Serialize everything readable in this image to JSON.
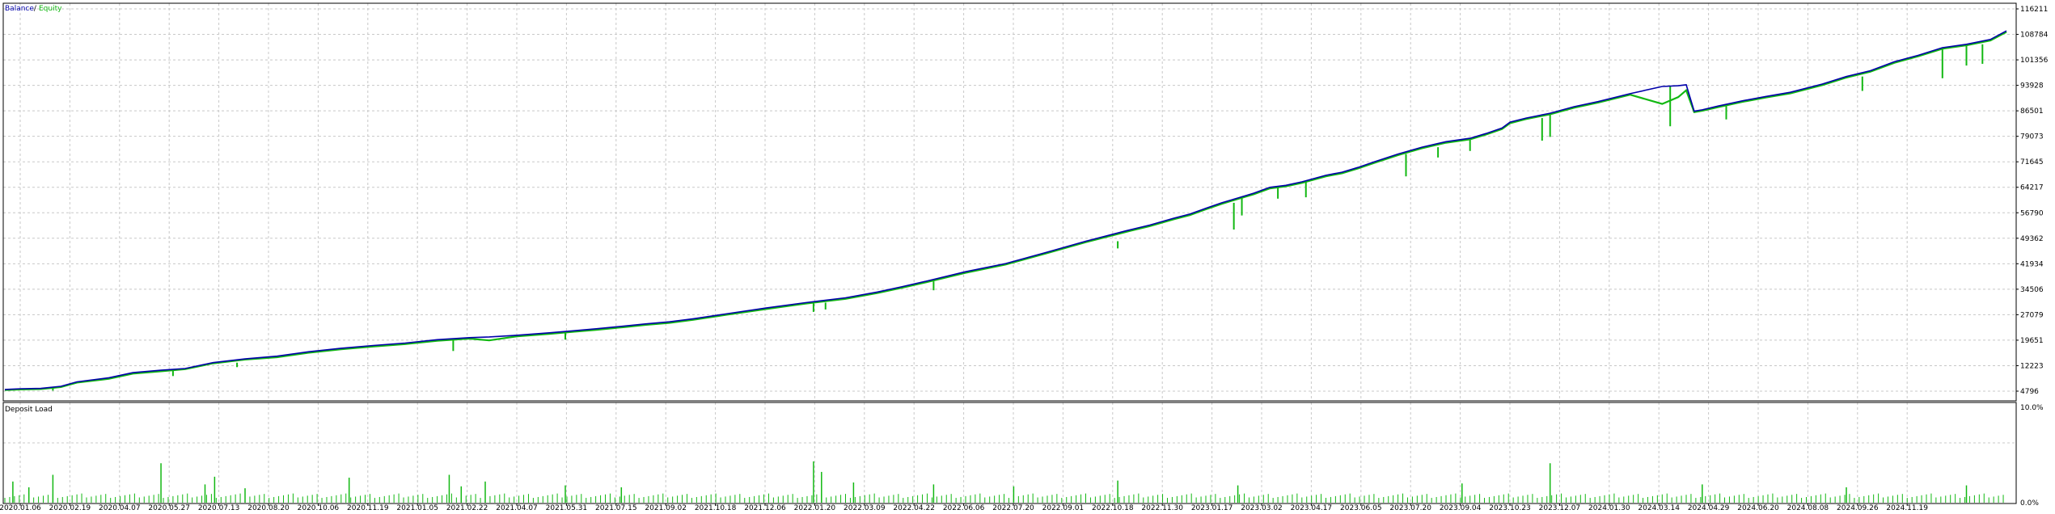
{
  "colors": {
    "balance": "#0000aa",
    "equity": "#12b812",
    "load": "#12b812",
    "grid": "#c8c8c8",
    "frame": "#000000",
    "background": "#ffffff"
  },
  "chart_data": [
    {
      "type": "line",
      "legend": {
        "balance_label": "Balance",
        "separator": " / ",
        "equity_label": "Equity",
        "placement": "top-left"
      },
      "grid": true,
      "x_ticks": [
        "2020.01.06",
        "2020.02.19",
        "2020.04.07",
        "2020.05.27",
        "2020.07.13",
        "2020.08.20",
        "2020.10.06",
        "2020.11.19",
        "2021.01.05",
        "2021.02.22",
        "2021.04.07",
        "2021.05.31",
        "2021.07.15",
        "2021.09.02",
        "2021.10.18",
        "2021.12.06",
        "2022.01.20",
        "2022.03.09",
        "2022.04.22",
        "2022.06.06",
        "2022.07.20",
        "2022.09.01",
        "2022.10.18",
        "2022.11.30",
        "2023.01.17",
        "2023.03.02",
        "2023.04.17",
        "2023.06.05",
        "2023.07.20",
        "2023.09.04",
        "2023.10.23",
        "2023.12.07",
        "2024.01.30",
        "2024.03.14",
        "2024.04.29",
        "2024.06.20",
        "2024.08.08",
        "2024.09.26",
        "2024.11.19"
      ],
      "y_ticks": [
        "116211",
        "108784",
        "101356",
        "93928",
        "86501",
        "79073",
        "71645",
        "64217",
        "56790",
        "49362",
        "41934",
        "34506",
        "27079",
        "19651",
        "12223",
        "4796"
      ],
      "ylim": [
        4796,
        116211
      ],
      "series": [
        {
          "name": "Balance",
          "x": [
            0,
            20,
            45,
            70,
            90,
            130,
            160,
            195,
            225,
            260,
            300,
            340,
            380,
            420,
            460,
            500,
            540,
            580,
            605,
            640,
            680,
            710,
            740,
            775,
            800,
            830,
            860,
            900,
            950,
            1000,
            1050,
            1090,
            1120,
            1150,
            1200,
            1250,
            1300,
            1350,
            1400,
            1430,
            1460,
            1480,
            1500,
            1520,
            1540,
            1560,
            1580,
            1600,
            1620,
            1650,
            1670,
            1690,
            1710,
            1740,
            1770,
            1800,
            1830,
            1850,
            1870,
            1880,
            1900,
            1930,
            1960,
            1990,
            2030,
            2070,
            2090,
            2100,
            2110,
            2120,
            2140,
            2170,
            2200,
            2230,
            2270,
            2300,
            2330,
            2360,
            2390,
            2420,
            2450,
            2480,
            2500
          ],
          "values": [
            5300,
            5500,
            5600,
            6200,
            7500,
            8700,
            10200,
            10900,
            11400,
            13100,
            14200,
            15000,
            16300,
            17300,
            18100,
            18800,
            19800,
            20400,
            20600,
            21100,
            21800,
            22400,
            23000,
            23800,
            24400,
            25000,
            25900,
            27300,
            29000,
            30600,
            32000,
            33700,
            35200,
            36800,
            39600,
            42000,
            45200,
            48500,
            51500,
            53200,
            55200,
            56400,
            58100,
            59700,
            61100,
            62500,
            64200,
            64800,
            65800,
            67700,
            68600,
            70000,
            71600,
            73900,
            75900,
            77500,
            78500,
            79900,
            81500,
            83200,
            84400,
            85800,
            87700,
            89200,
            91500,
            93600,
            93800,
            94100,
            86400,
            86800,
            87900,
            89400,
            90700,
            91900,
            94300,
            96500,
            98200,
            100800,
            102700,
            104900,
            105900,
            107300,
            109800
          ]
        },
        {
          "name": "Equity",
          "x": [
            0,
            20,
            45,
            70,
            90,
            130,
            160,
            195,
            225,
            260,
            300,
            340,
            380,
            420,
            460,
            500,
            540,
            580,
            605,
            640,
            680,
            710,
            740,
            775,
            800,
            830,
            860,
            900,
            950,
            1000,
            1050,
            1090,
            1120,
            1150,
            1200,
            1250,
            1300,
            1350,
            1400,
            1430,
            1460,
            1480,
            1500,
            1520,
            1540,
            1560,
            1580,
            1600,
            1620,
            1650,
            1670,
            1690,
            1710,
            1740,
            1770,
            1800,
            1830,
            1850,
            1870,
            1880,
            1900,
            1930,
            1960,
            1990,
            2030,
            2070,
            2090,
            2100,
            2110,
            2120,
            2140,
            2170,
            2200,
            2230,
            2270,
            2300,
            2330,
            2360,
            2390,
            2420,
            2450,
            2480,
            2500
          ],
          "values": [
            5100,
            5300,
            5400,
            6000,
            7300,
            8400,
            9900,
            10600,
            11200,
            12900,
            14000,
            14700,
            16000,
            17000,
            17800,
            18500,
            19500,
            20100,
            19600,
            20800,
            21500,
            22100,
            22700,
            23500,
            24100,
            24700,
            25600,
            27000,
            28700,
            30300,
            31700,
            33400,
            34900,
            36500,
            39300,
            41700,
            44900,
            48200,
            51200,
            52900,
            54900,
            56100,
            57800,
            59400,
            60800,
            62200,
            63900,
            64500,
            65500,
            67400,
            68300,
            69700,
            71300,
            73600,
            75600,
            77200,
            78200,
            79600,
            81200,
            82900,
            84100,
            85500,
            87400,
            88900,
            91200,
            88500,
            90500,
            92500,
            86100,
            86500,
            87600,
            89100,
            90400,
            91600,
            94000,
            96200,
            97900,
            100500,
            102400,
            104600,
            105600,
            107000,
            109500
          ]
        }
      ],
      "equity_dips": [
        {
          "x": 60,
          "value": 4950
        },
        {
          "x": 210,
          "value": 9200
        },
        {
          "x": 290,
          "value": 11800
        },
        {
          "x": 560,
          "value": 16500
        },
        {
          "x": 700,
          "value": 19800
        },
        {
          "x": 1010,
          "value": 27900
        },
        {
          "x": 1025,
          "value": 28600
        },
        {
          "x": 1160,
          "value": 34200
        },
        {
          "x": 1390,
          "value": 46400
        },
        {
          "x": 1535,
          "value": 51900
        },
        {
          "x": 1545,
          "value": 56000
        },
        {
          "x": 1590,
          "value": 60900
        },
        {
          "x": 1625,
          "value": 61300
        },
        {
          "x": 1750,
          "value": 67400
        },
        {
          "x": 1790,
          "value": 72900
        },
        {
          "x": 1830,
          "value": 74800
        },
        {
          "x": 1920,
          "value": 77800
        },
        {
          "x": 1930,
          "value": 78900
        },
        {
          "x": 2080,
          "value": 82000
        },
        {
          "x": 2150,
          "value": 84000
        },
        {
          "x": 2320,
          "value": 92300
        },
        {
          "x": 2420,
          "value": 96000
        },
        {
          "x": 2450,
          "value": 99700
        },
        {
          "x": 2470,
          "value": 100200
        }
      ]
    },
    {
      "type": "bar",
      "title": "Deposit Load",
      "y_ticks": [
        "10.0%",
        "0.0%"
      ],
      "ylim": [
        0,
        10
      ],
      "spikes": [
        {
          "x": 10,
          "value": 2.2
        },
        {
          "x": 30,
          "value": 1.6
        },
        {
          "x": 60,
          "value": 2.9
        },
        {
          "x": 195,
          "value": 4.1
        },
        {
          "x": 250,
          "value": 1.9
        },
        {
          "x": 262,
          "value": 2.7
        },
        {
          "x": 300,
          "value": 1.5
        },
        {
          "x": 430,
          "value": 2.6
        },
        {
          "x": 555,
          "value": 2.9
        },
        {
          "x": 570,
          "value": 1.7
        },
        {
          "x": 600,
          "value": 2.2
        },
        {
          "x": 700,
          "value": 1.8
        },
        {
          "x": 770,
          "value": 1.6
        },
        {
          "x": 1010,
          "value": 4.3
        },
        {
          "x": 1020,
          "value": 3.2
        },
        {
          "x": 1060,
          "value": 2.1
        },
        {
          "x": 1160,
          "value": 1.9
        },
        {
          "x": 1260,
          "value": 1.7
        },
        {
          "x": 1390,
          "value": 2.3
        },
        {
          "x": 1540,
          "value": 1.8
        },
        {
          "x": 1820,
          "value": 2.0
        },
        {
          "x": 1930,
          "value": 4.1
        },
        {
          "x": 2120,
          "value": 1.9
        },
        {
          "x": 2300,
          "value": 1.6
        },
        {
          "x": 2450,
          "value": 1.8
        }
      ]
    }
  ]
}
